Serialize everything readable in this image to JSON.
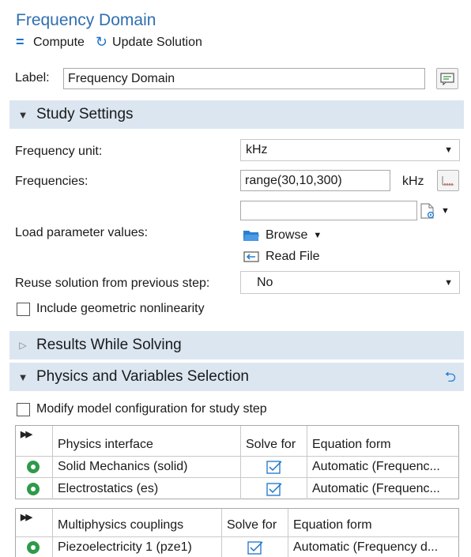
{
  "header": {
    "title": "Frequency Domain",
    "compute_label": "Compute",
    "update_label": "Update Solution"
  },
  "label_field": {
    "label": "Label:",
    "value": "Frequency Domain"
  },
  "sections": {
    "study_settings": "Study Settings",
    "results_while_solving": "Results While Solving",
    "physics_selection": "Physics and Variables Selection"
  },
  "study_settings": {
    "frequency_unit_label": "Frequency unit:",
    "frequency_unit_value": "kHz",
    "frequencies_label": "Frequencies:",
    "frequencies_value": "range(30,10,300)",
    "frequencies_unit": "kHz",
    "extra_input_value": "",
    "load_param_label": "Load parameter values:",
    "browse_label": "Browse",
    "read_file_label": "Read File",
    "reuse_label": "Reuse solution from previous step:",
    "reuse_value": "No",
    "geom_nonlinearity_label": "Include geometric nonlinearity"
  },
  "physics_selection": {
    "modify_config_label": "Modify model configuration for study step",
    "physics_table": {
      "headers": [
        "Physics interface",
        "Solve for",
        "Equation form"
      ],
      "rows": [
        {
          "name": "Solid Mechanics (solid)",
          "equation": "Automatic (Frequenc..."
        },
        {
          "name": "Electrostatics (es)",
          "equation": "Automatic (Frequenc..."
        }
      ]
    },
    "multiphysics_table": {
      "headers": [
        "Multiphysics couplings",
        "Solve for",
        "Equation form"
      ],
      "rows": [
        {
          "name": "Piezoelectricity 1 (pze1)",
          "equation": "Automatic (Frequency d..."
        }
      ]
    }
  },
  "colors": {
    "title": "#2f6fb0",
    "section_bg": "#dbe6f1",
    "radio": "#2e9a4a",
    "check": "#1a74c8"
  }
}
